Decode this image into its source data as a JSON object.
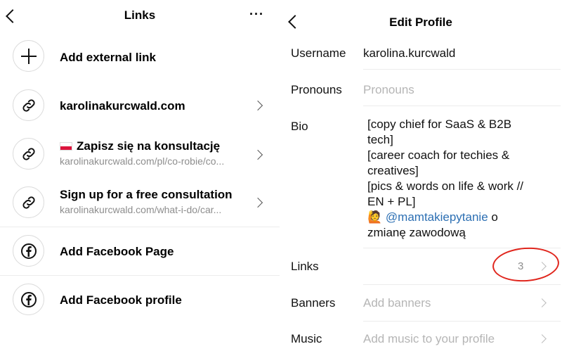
{
  "left": {
    "title": "Links",
    "more_label": "···",
    "items": [
      {
        "title": "Add external link",
        "icon": "plus-icon"
      },
      {
        "title": "karolinakurcwald.com",
        "icon": "link-icon"
      },
      {
        "title": "Zapisz się na konsultację",
        "subtitle": "karolinakurcwald.com/pl/co-robie/co...",
        "icon": "link-icon"
      },
      {
        "title": "Sign up for a free consultation",
        "subtitle": "karolinakurcwald.com/what-i-do/car...",
        "icon": "link-icon"
      },
      {
        "title": "Add Facebook Page",
        "icon": "facebook-icon"
      },
      {
        "title": "Add Facebook profile",
        "icon": "facebook-icon"
      }
    ]
  },
  "right": {
    "title": "Edit Profile",
    "fields": {
      "username": {
        "label": "Username",
        "value": "karolina.kurcwald"
      },
      "pronouns": {
        "label": "Pronouns",
        "placeholder": "Pronouns"
      },
      "bio": {
        "label": "Bio",
        "lines": [
          "[copy chief for SaaS & B2B",
          "tech]",
          "[career coach for techies &",
          "creatives]",
          "[pics & words on life & work //",
          "EN + PL]"
        ],
        "emoji": "🙋",
        "mention": "@mamtakiepytanie",
        "mention_suffix": " o",
        "last_line": "zmianę zawodową"
      },
      "links": {
        "label": "Links",
        "count": "3"
      },
      "banners": {
        "label": "Banners",
        "placeholder": "Add banners"
      },
      "music": {
        "label": "Music",
        "placeholder": "Add music to your profile"
      }
    }
  },
  "colors": {
    "accent_mention": "#2c6fb3",
    "annotation_red": "#e0261d",
    "placeholder_gray": "#b5b5b5"
  }
}
